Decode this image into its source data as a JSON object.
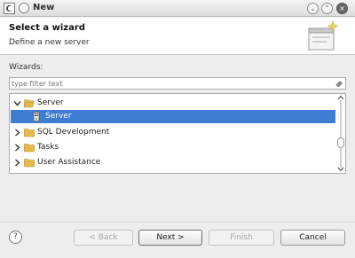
{
  "window": {
    "title": "New",
    "minimize_glyph": "⌄",
    "maximize_glyph": "⌃",
    "close_glyph": "×"
  },
  "banner": {
    "title": "Select a wizard",
    "description": "Define a new server"
  },
  "wizards": {
    "label": "Wizards:",
    "filter_placeholder": "type filter text",
    "tree": [
      {
        "label": "Server",
        "expanded": true,
        "level": 0,
        "icon": "folder-icon"
      },
      {
        "label": "Server",
        "level": 1,
        "selected": true,
        "icon": "server-icon"
      },
      {
        "label": "SQL Development",
        "expanded": false,
        "level": 0,
        "icon": "folder-icon"
      },
      {
        "label": "Tasks",
        "expanded": false,
        "level": 0,
        "icon": "folder-icon"
      },
      {
        "label": "User Assistance",
        "expanded": false,
        "level": 0,
        "icon": "folder-icon"
      }
    ]
  },
  "buttons": {
    "help": "?",
    "back": "< Back",
    "next": "Next >",
    "finish": "Finish",
    "cancel": "Cancel"
  },
  "colors": {
    "selection": "#3f7dd3",
    "folder": "#e8b84a"
  }
}
